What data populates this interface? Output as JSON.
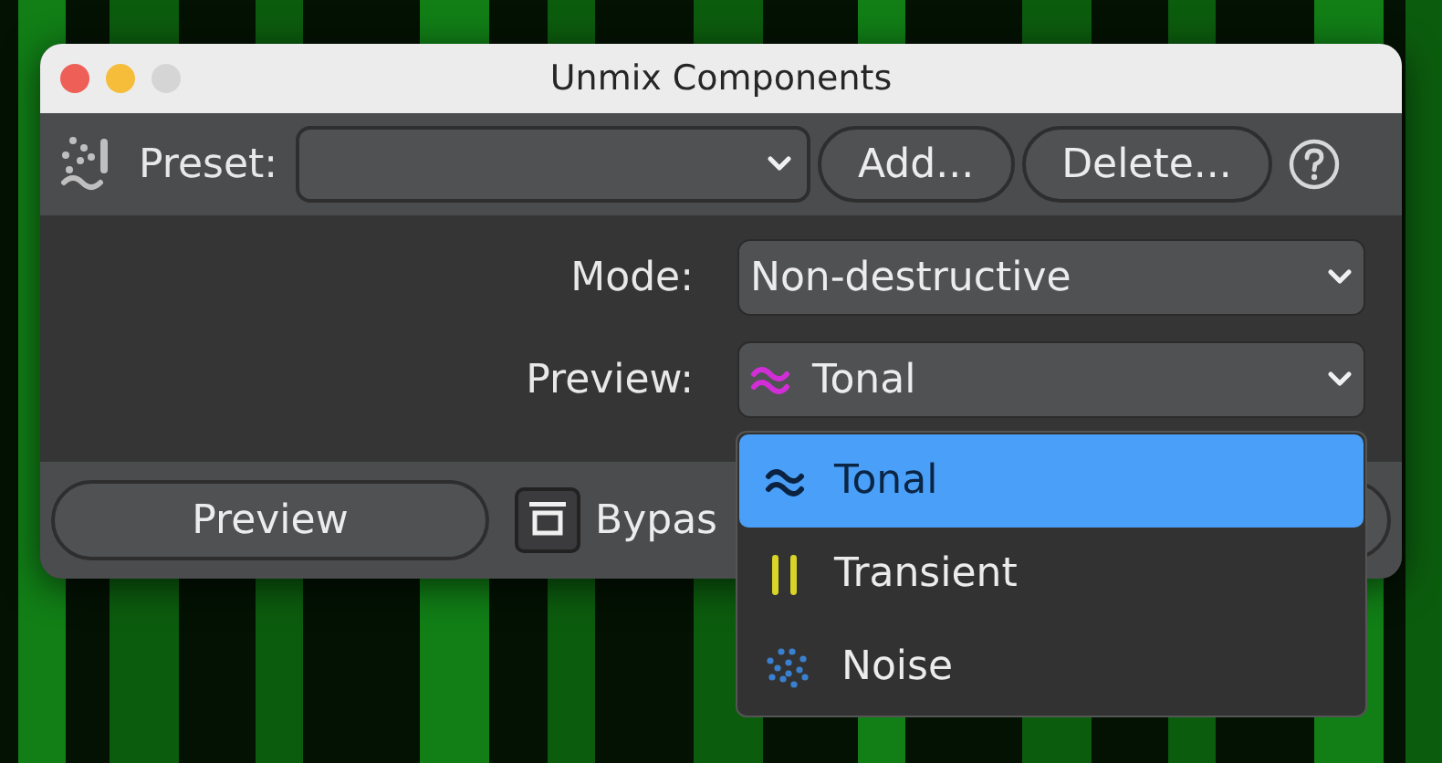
{
  "window": {
    "title": "Unmix Components"
  },
  "toolbar": {
    "preset_label": "Preset:",
    "buttons": [
      "Add...",
      "Delete..."
    ]
  },
  "fields": [
    {
      "label": "Mode:",
      "value": "Non-destructive"
    },
    {
      "label": "Preview:",
      "value": "Tonal",
      "kind": "tonal"
    }
  ],
  "dropdown": {
    "options": [
      {
        "label": "Tonal",
        "kind": "tonal",
        "selected": true
      },
      {
        "label": "Transient",
        "kind": "transient",
        "selected": false
      },
      {
        "label": "Noise",
        "kind": "noise",
        "selected": false
      }
    ]
  },
  "bottom": {
    "preview_button": "Preview",
    "bypass_label": "Bypas",
    "bypass_checked": false
  }
}
